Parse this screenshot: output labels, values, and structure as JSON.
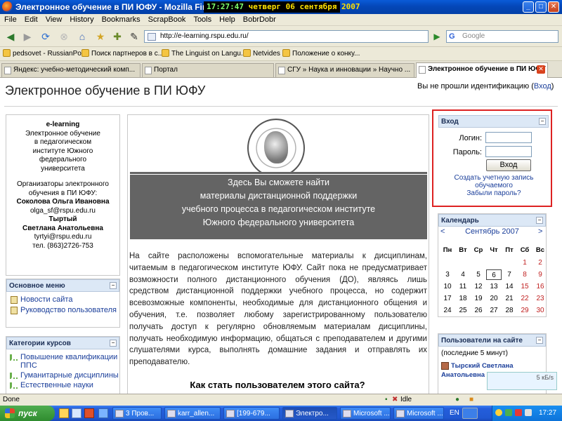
{
  "window": {
    "title": "Электронное обучение в ПИ ЮФУ - Mozilla Firefox",
    "clock_time": "17:27:47",
    "clock_date": "четверг 06 сентября 2007"
  },
  "menubar": [
    "File",
    "Edit",
    "View",
    "History",
    "Bookmarks",
    "ScrapBook",
    "Tools",
    "Help",
    "BobrDobr"
  ],
  "nav": {
    "url": "http://e-learning.rspu.edu.ru/",
    "search_placeholder": "Google"
  },
  "bookmarks": [
    "pedsovet - RussianPo...",
    "Поиск партнеров в с...",
    "The Linguist on Langu...",
    "Netvides",
    "Положение о конку..."
  ],
  "tabs": [
    {
      "label": "Яндекс: учебно-методический комп...",
      "active": false
    },
    {
      "label": "Портал",
      "active": false
    },
    {
      "label": "СГУ » Наука и инновации » Научно ...",
      "active": false
    },
    {
      "label": "Электронное обучение в ПИ ЮФУ",
      "active": true
    }
  ],
  "page": {
    "site_title": "Электронное обучение в ПИ ЮФУ",
    "login_status_text": "Вы не прошли идентификацию (",
    "login_status_link": "Вход",
    "login_status_end": ")",
    "info": {
      "heading": "e-learning",
      "lines": [
        "Электронное обучение",
        "в педагогическом",
        "институте Южного",
        "федерального",
        "университета"
      ],
      "org_lines": [
        "Организаторы электронного",
        "обучения в ПИ ЮФУ:"
      ],
      "person1": "Соколова Ольга Ивановна",
      "person1_email": "olga_sf@rspu.edu.ru",
      "person2_line1": "Тыртый",
      "person2_line2": "Светлана Анатольевна",
      "person2_email": "tyrtyi@rspu.edu.ru",
      "phone": "тел. (863)2726-753"
    },
    "main_menu": {
      "title": "Основное меню",
      "items": [
        "Новости сайта",
        "Руководство пользователя"
      ]
    },
    "categories": {
      "title": "Категории курсов",
      "items": [
        "Повышение квалификации ППС",
        "Гуманитарные дисциплины",
        "Естественные науки"
      ]
    },
    "banner_lines": [
      "Здесь Вы сможете найти",
      "материалы дистанционной поддержки",
      "учебного процесса в педагогическом институте",
      "Южного федерального университета"
    ],
    "body_text": "На сайте расположены вспомогательные материалы к дисциплинам, читаемым в педагогическом институте ЮФУ. Сайт пока не предусматривает возможности полного дистанционного обучения (ДО), являясь лишь средством дистанционной поддержки учебного процесса, но содержит всевозможные компоненты, необходимые для дистанционного общения и обучения, т.е. позволяет любому зарегистрированному пользователю получать доступ к регулярно обновляемым материалам дисциплины, получать необходимую информацию, общаться с преподавателем и другими слушателями курса, выполнять домашние задания и отправлять их преподавателю.",
    "howto_heading": "Как стать пользователем этого сайта?",
    "login": {
      "title": "Вход",
      "login_label": "Логин:",
      "password_label": "Пароль:",
      "button": "Вход",
      "create_account": "Создать учетную запись обучаемого",
      "forgot": "Забыли пароль?"
    },
    "calendar": {
      "title": "Календарь",
      "prev": "<",
      "next": ">",
      "month": "Сентябрь 2007",
      "days": [
        "Пн",
        "Вт",
        "Ср",
        "Чт",
        "Пт",
        "Сб",
        "Вс"
      ],
      "weeks": [
        [
          "",
          "",
          "",
          "",
          "",
          "1",
          "2"
        ],
        [
          "3",
          "4",
          "5",
          "6",
          "7",
          "8",
          "9"
        ],
        [
          "10",
          "11",
          "12",
          "13",
          "14",
          "15",
          "16"
        ],
        [
          "17",
          "18",
          "19",
          "20",
          "21",
          "22",
          "23"
        ],
        [
          "24",
          "25",
          "26",
          "27",
          "28",
          "29",
          "30"
        ]
      ],
      "today": "6"
    },
    "users": {
      "title": "Пользователи на сайте",
      "period": "(последние 5 минут)",
      "user_line1": "Тырский Светлана",
      "user_line2": "Анатольевна"
    },
    "side_badge": "5 кБ/s"
  },
  "statusbar": {
    "text": "Done",
    "idle": "Idle"
  },
  "taskbar": {
    "start": "пуск",
    "tasks": [
      "3 Пров...",
      "karr_allen...",
      "[199-679...",
      "Электро...",
      "Microsoft ...",
      "Microsoft ..."
    ],
    "lang": "EN",
    "time": "17:27"
  }
}
